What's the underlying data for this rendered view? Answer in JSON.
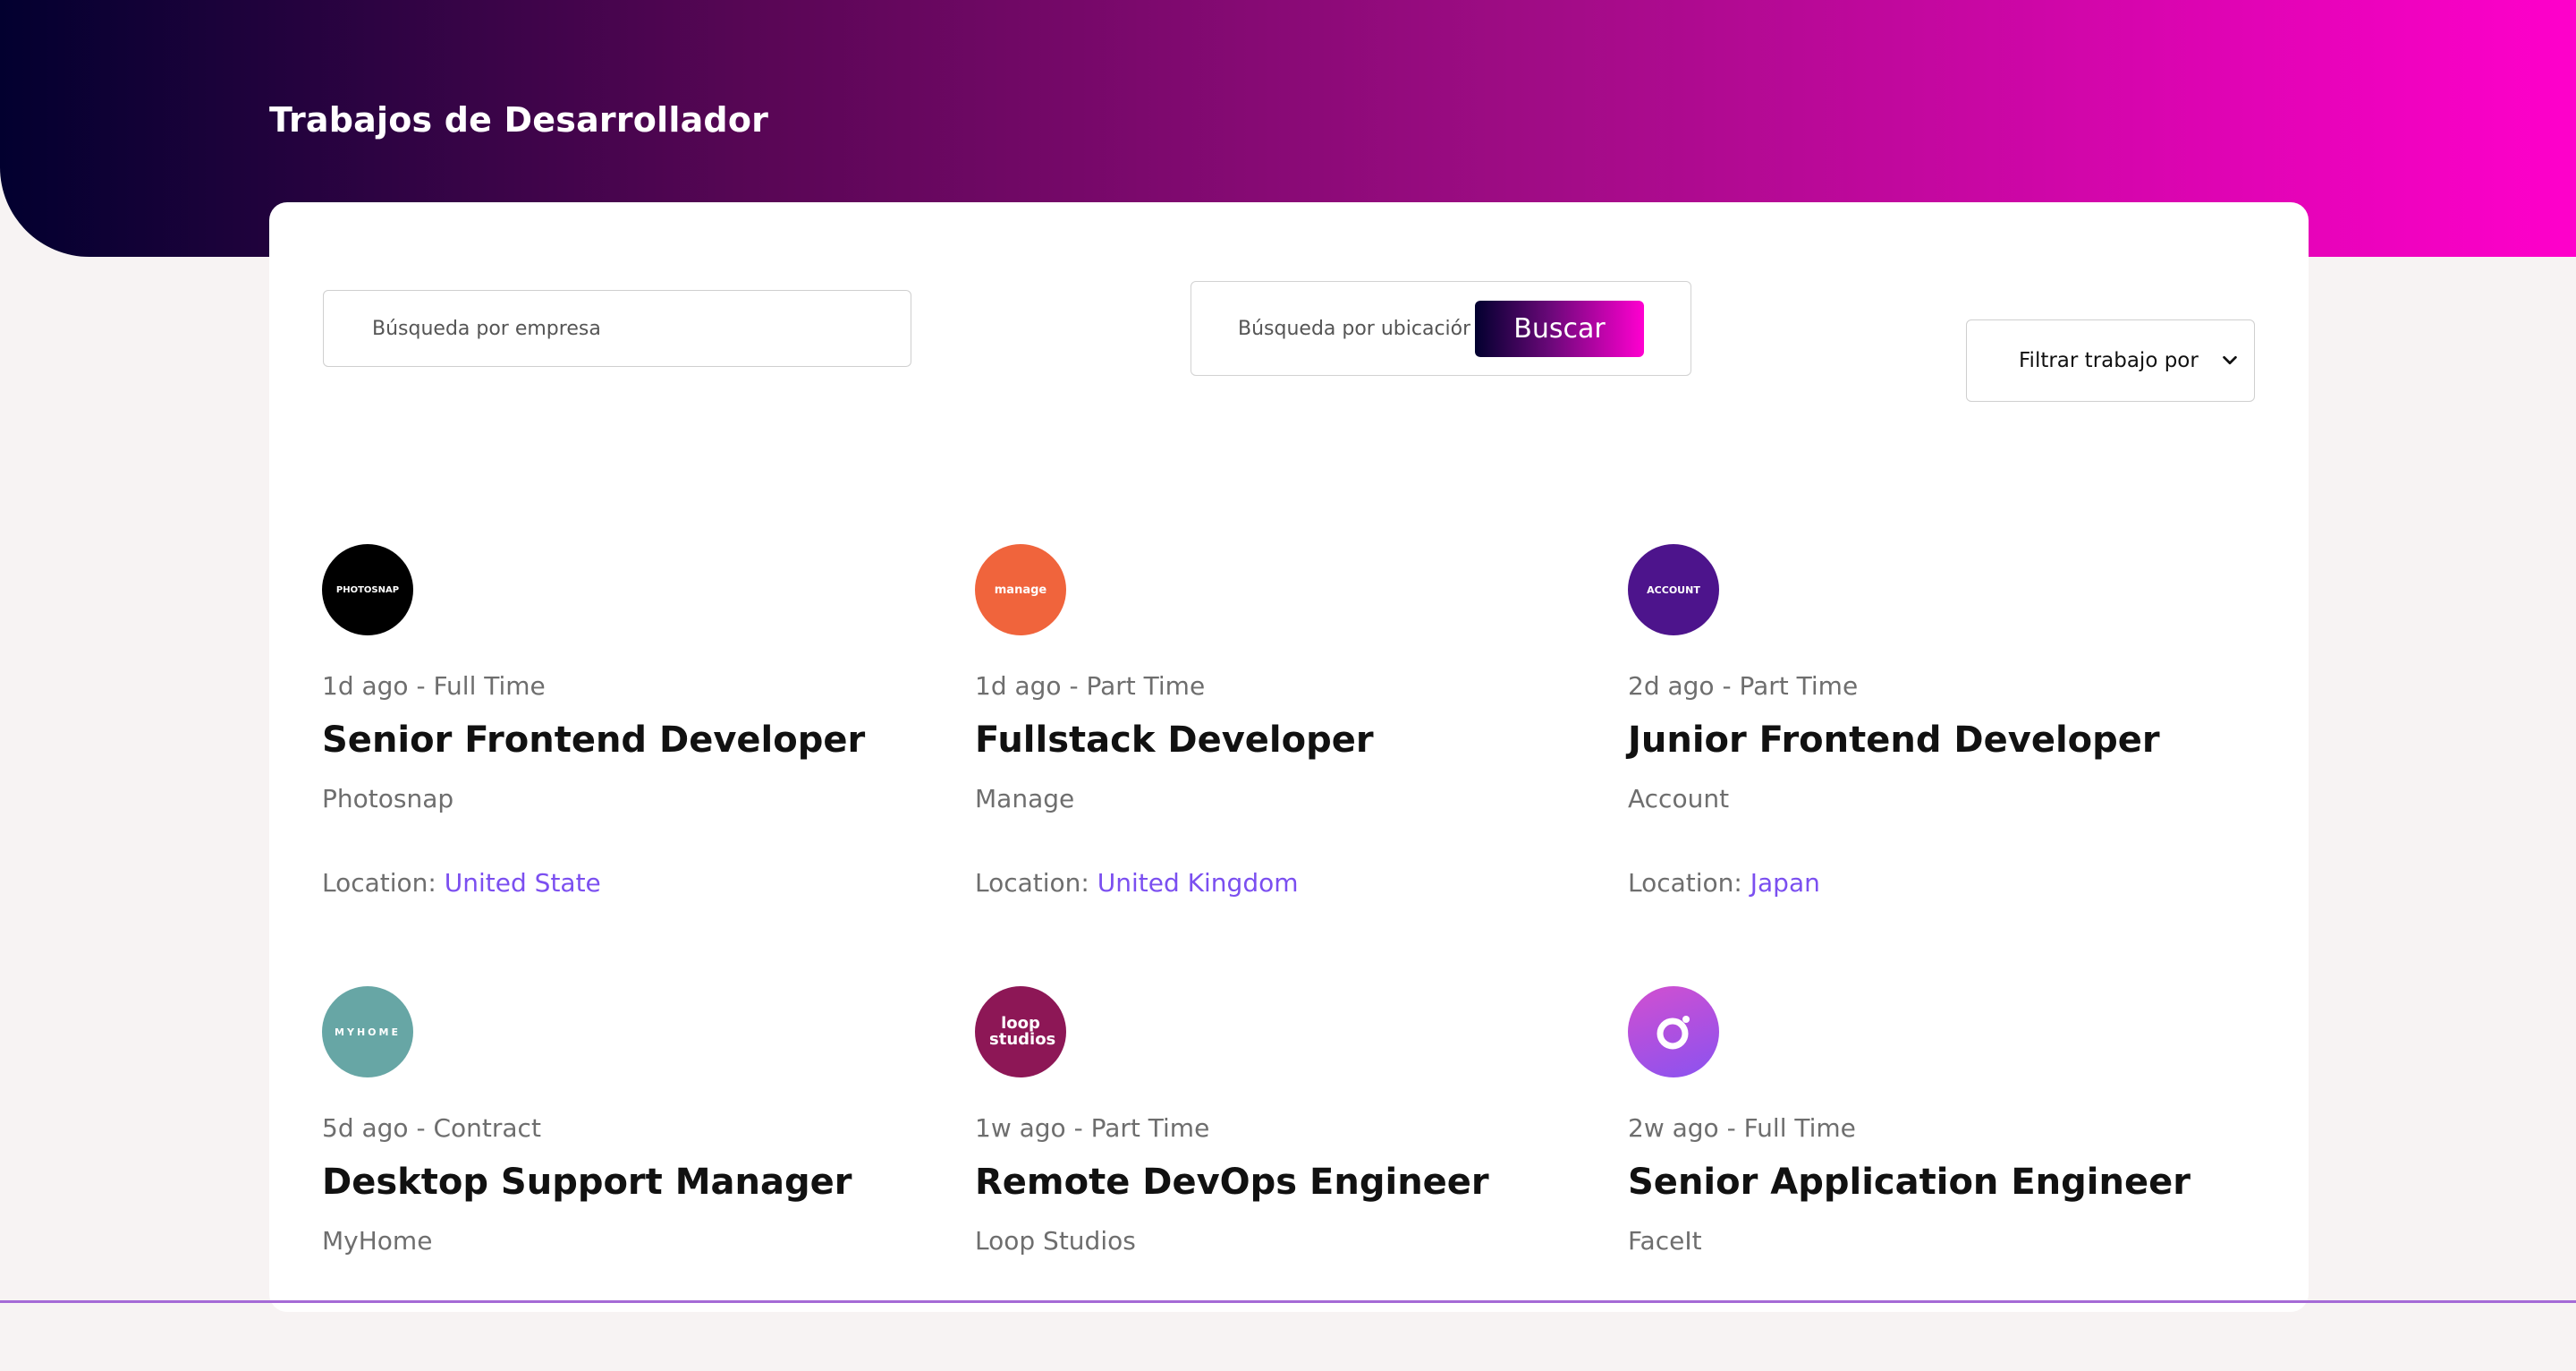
{
  "header": {
    "title": "Trabajos de Desarrollador"
  },
  "search": {
    "company_placeholder": "Búsqueda por empresa",
    "location_placeholder": "Búsqueda por ubicación",
    "button_label": "Buscar",
    "filter_label": "Filtrar trabajo por"
  },
  "location_label": "Location:",
  "jobs": [
    {
      "logo_text": "PHOTOSNAP",
      "logo_color": "#000000",
      "posted": "1d ago",
      "contract": "Full Time",
      "title": "Senior Frontend Developer",
      "company": "Photosnap",
      "location": "United State"
    },
    {
      "logo_text": "manage",
      "logo_color": "#f0643c",
      "posted": "1d ago",
      "contract": "Part Time",
      "title": "Fullstack Developer",
      "company": "Manage",
      "location": "United Kingdom"
    },
    {
      "logo_text": "ACCOUNT",
      "logo_color": "#4d148c",
      "posted": "2d ago",
      "contract": "Part Time",
      "title": "Junior Frontend Developer",
      "company": "Account",
      "location": "Japan"
    },
    {
      "logo_text": "MYHOME",
      "logo_color": "#67a6a5",
      "posted": "5d ago",
      "contract": "Contract",
      "title": "Desktop Support Manager",
      "company": "MyHome",
      "location": ""
    },
    {
      "logo_text": "loop studios",
      "logo_color": "#8d1756",
      "posted": "1w ago",
      "contract": "Part Time",
      "title": "Remote DevOps Engineer",
      "company": "Loop Studios",
      "location": ""
    },
    {
      "logo_text": "",
      "logo_color": "#a24fe8",
      "posted": "2w ago",
      "contract": "Full Time",
      "title": "Senior Application Engineer",
      "company": "FaceIt",
      "location": ""
    }
  ],
  "icons": {
    "filter_dropdown": "chevron-down-icon",
    "faceit_logo": "ring-icon"
  }
}
